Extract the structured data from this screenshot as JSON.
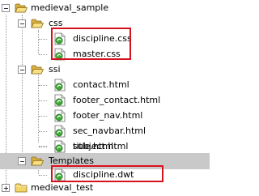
{
  "tree": {
    "root": {
      "label": "medieval_sample",
      "icon": "open-folder-icon"
    },
    "css": {
      "label": "css",
      "files": [
        {
          "label": "discipline.css",
          "icon": "dreamweaver-file-icon",
          "highlighted": true
        },
        {
          "label": "master.css",
          "icon": "dreamweaver-file-icon",
          "highlighted": true
        }
      ]
    },
    "ssi": {
      "label": "ssi",
      "files": [
        {
          "label": "contact.html",
          "icon": "dreamweaver-file-icon"
        },
        {
          "label": "footer_contact.html",
          "icon": "dreamweaver-file-icon"
        },
        {
          "label": "footer_nav.html",
          "icon": "dreamweaver-file-icon"
        },
        {
          "label": "sec_navbar.html",
          "icon": "dreamweaver-file-icon"
        },
        {
          "label": "subject.html",
          "icon": "dreamweaver-file-icon"
        },
        {
          "label": "title.html",
          "icon": "dreamweaver-file-icon"
        }
      ]
    },
    "templates": {
      "label": "Templates",
      "selected": true,
      "files": [
        {
          "label": "discipline.dwt",
          "icon": "dreamweaver-file-icon",
          "highlighted": true
        }
      ]
    },
    "sibling": {
      "label": "medieval_test",
      "icon": "closed-folder-icon",
      "collapsed": true
    }
  },
  "colors": {
    "highlight_border": "#d8121c",
    "selected_row": "#c9c9c9",
    "folder_yellow": "#f2d56b",
    "file_green": "#3aa832"
  }
}
